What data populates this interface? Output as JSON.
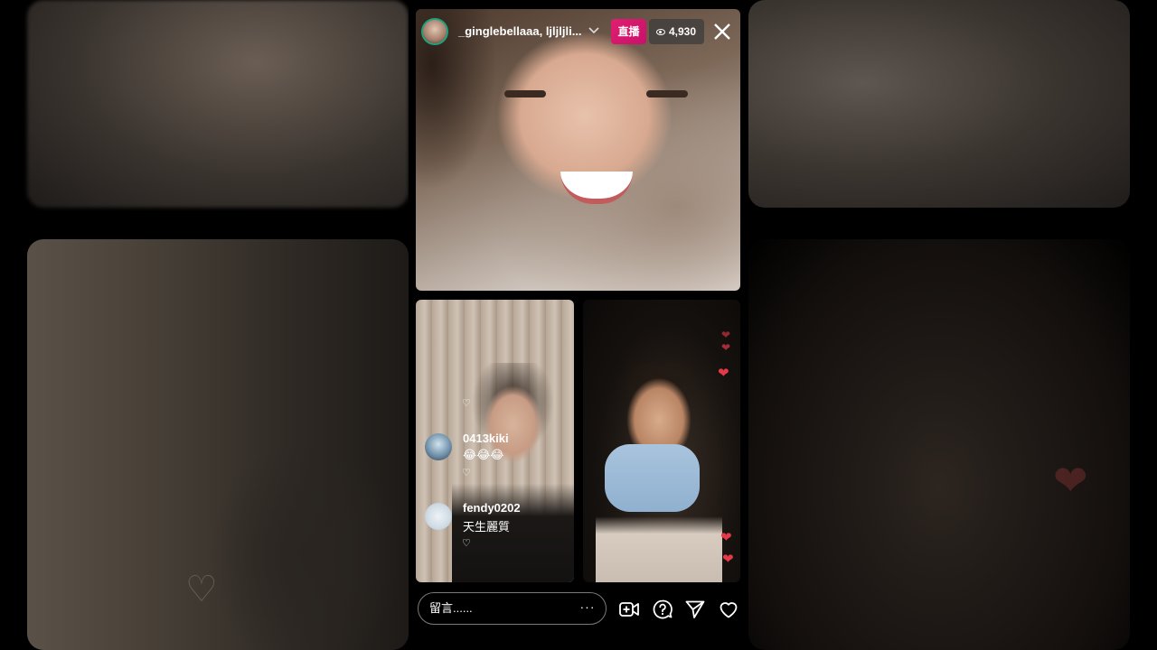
{
  "header": {
    "username": "_ginglebellaaa, ljljljli...",
    "live_label": "直播",
    "viewer_count": "4,930"
  },
  "comments": [
    {
      "user": "0413kiki",
      "text": "😂😂😂"
    },
    {
      "user": "fendy0202",
      "text": "天生麗質"
    }
  ],
  "footer": {
    "comment_placeholder": "留言......",
    "more_label": "···"
  },
  "icons": {
    "close": "close-icon",
    "add_video": "add-video-icon",
    "question": "question-icon",
    "share": "send-icon",
    "like": "heart-icon"
  },
  "colors": {
    "live_badge": "#d4156c",
    "heart": "#e53949",
    "avatar_ring": "#1fa27a"
  }
}
